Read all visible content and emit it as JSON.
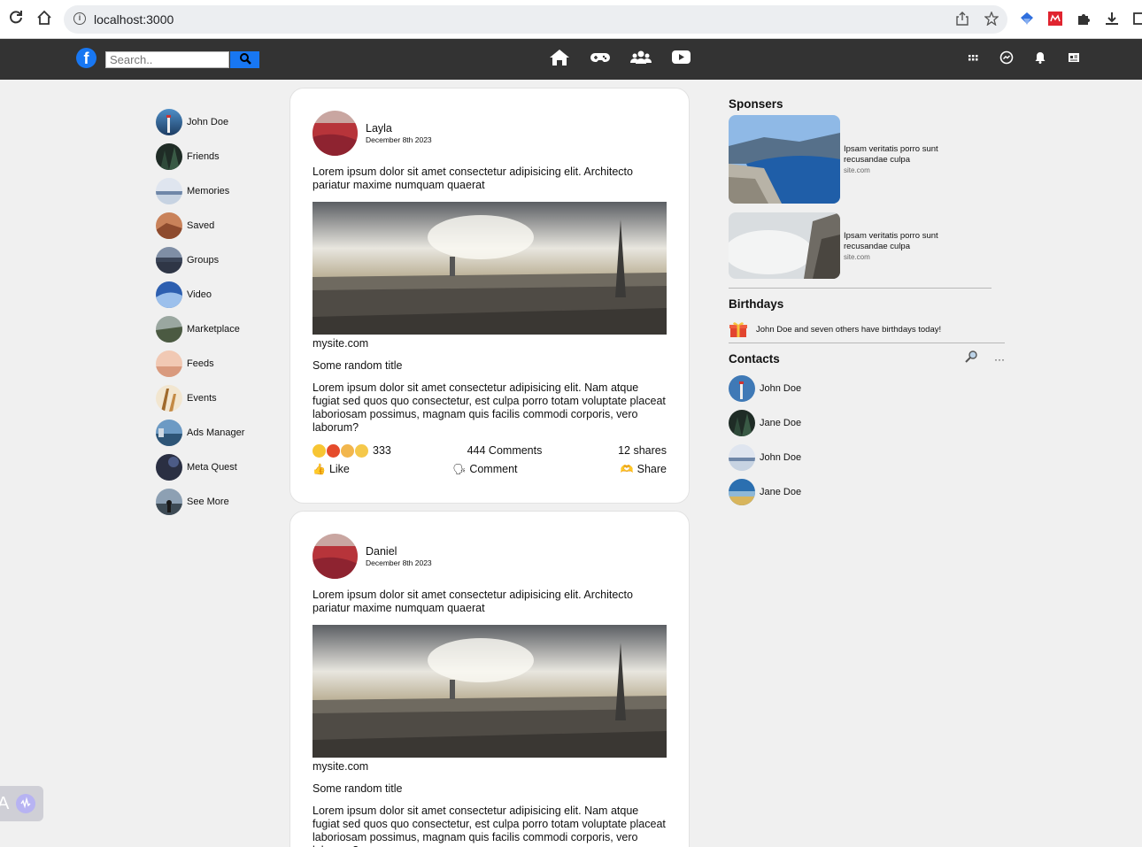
{
  "browser": {
    "url": "localhost:3000"
  },
  "topnav": {
    "logo_letter": "f",
    "search_placeholder": "Search.."
  },
  "sidebar": {
    "items": [
      {
        "label": "John Doe",
        "icon": "user-avatar"
      },
      {
        "label": "Friends",
        "icon": "friends-image"
      },
      {
        "label": "Memories",
        "icon": "memories-image"
      },
      {
        "label": "Saved",
        "icon": "saved-image"
      },
      {
        "label": "Groups",
        "icon": "groups-image"
      },
      {
        "label": "Video",
        "icon": "video-image"
      },
      {
        "label": "Marketplace",
        "icon": "marketplace-image"
      },
      {
        "label": "Feeds",
        "icon": "feeds-image"
      },
      {
        "label": "Events",
        "icon": "events-image"
      },
      {
        "label": "Ads Manager",
        "icon": "ads-image"
      },
      {
        "label": "Meta Quest",
        "icon": "metaquest-image"
      },
      {
        "label": "See More",
        "icon": "seemore-image"
      }
    ]
  },
  "posts": [
    {
      "author": "Layla",
      "date": "December 8th 2023",
      "text": "Lorem ipsum dolor sit amet consectetur adipisicing elit. Architecto pariatur maxime numquam quaerat",
      "site": "mysite.com",
      "title": "Some random title",
      "body": "Lorem ipsum dolor sit amet consectetur adipisicing elit. Nam atque fugiat sed quos quo consectetur, est culpa porro totam voluptate placeat laboriosam possimus, magnam quis facilis commodi corporis, vero laborum?",
      "reactions": "333",
      "comments": "444 Comments",
      "shares": "12 shares",
      "like_label": "Like",
      "comment_label": "Comment",
      "share_label": "Share"
    },
    {
      "author": "Daniel",
      "date": "December 8th 2023",
      "text": "Lorem ipsum dolor sit amet consectetur adipisicing elit. Architecto pariatur maxime numquam quaerat",
      "site": "mysite.com",
      "title": "Some random title",
      "body": "Lorem ipsum dolor sit amet consectetur adipisicing elit. Nam atque fugiat sed quos quo consectetur, est culpa porro totam voluptate placeat laboriosam possimus, magnam quis facilis commodi corporis, vero laborum?"
    }
  ],
  "right": {
    "sponsors_title": "Sponsers",
    "sponsors": [
      {
        "text": "Ipsam veritatis porro sunt recusandae culpa",
        "site": "site.com"
      },
      {
        "text": "Ipsam veritatis porro sunt recusandae culpa",
        "site": "site.com"
      }
    ],
    "birthdays_title": "Birthdays",
    "birthday_text": "John Doe and seven others have birthdays today!",
    "contacts_title": "Contacts",
    "contacts_more": "···",
    "contacts": [
      {
        "name": "John Doe"
      },
      {
        "name": "Jane Doe"
      },
      {
        "name": "John Doe"
      },
      {
        "name": "Jane Doe"
      }
    ]
  },
  "colors": {
    "brand": "#1877f2",
    "nav_bg": "#333333",
    "page_bg": "#f0f0f0"
  }
}
